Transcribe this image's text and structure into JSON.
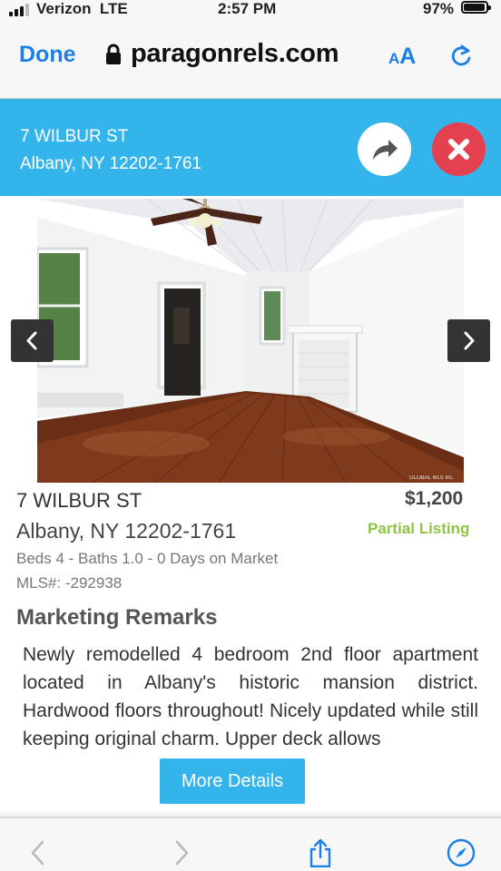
{
  "status_bar": {
    "carrier": "Verizon",
    "network": "LTE",
    "time": "2:57 PM",
    "battery_percent": "97%",
    "battery_level": 0.97
  },
  "browser": {
    "done_label": "Done",
    "url": "paragonrels.com",
    "text_size_small": "A",
    "text_size_large": "A",
    "icons": [
      "lock-icon",
      "reload-icon"
    ],
    "accent_color": "#1a7fe6"
  },
  "header": {
    "street": "7 WILBUR ST",
    "city_line": "Albany, NY 12202-1761",
    "background_color": "#33b5ec",
    "icons": [
      "share-icon",
      "close-icon"
    ]
  },
  "gallery": {
    "icons": [
      "chevron-left-icon",
      "chevron-right-icon"
    ],
    "watermark": "GLOBAL MLS Inc."
  },
  "listing": {
    "street": "7 WILBUR ST",
    "city_line": "Albany, NY 12202-1761",
    "price": "$1,200",
    "status": "Partial Listing",
    "details": "Beds 4 - Baths 1.0 - 0 Days on Market",
    "mls": "MLS#: -292938",
    "remarks_title": "Marketing Remarks",
    "remarks": "Newly remodelled 4 bedroom 2nd floor apartment located in Albany's historic mansion district. Hardwood floors throughout! Nicely updated while still keeping original charm. Upper deck allows",
    "more_button": "More Details",
    "status_color": "#8dc63f"
  },
  "bottom_toolbar": {
    "icons": [
      "back-icon",
      "forward-icon",
      "share-icon",
      "compass-icon"
    ]
  }
}
